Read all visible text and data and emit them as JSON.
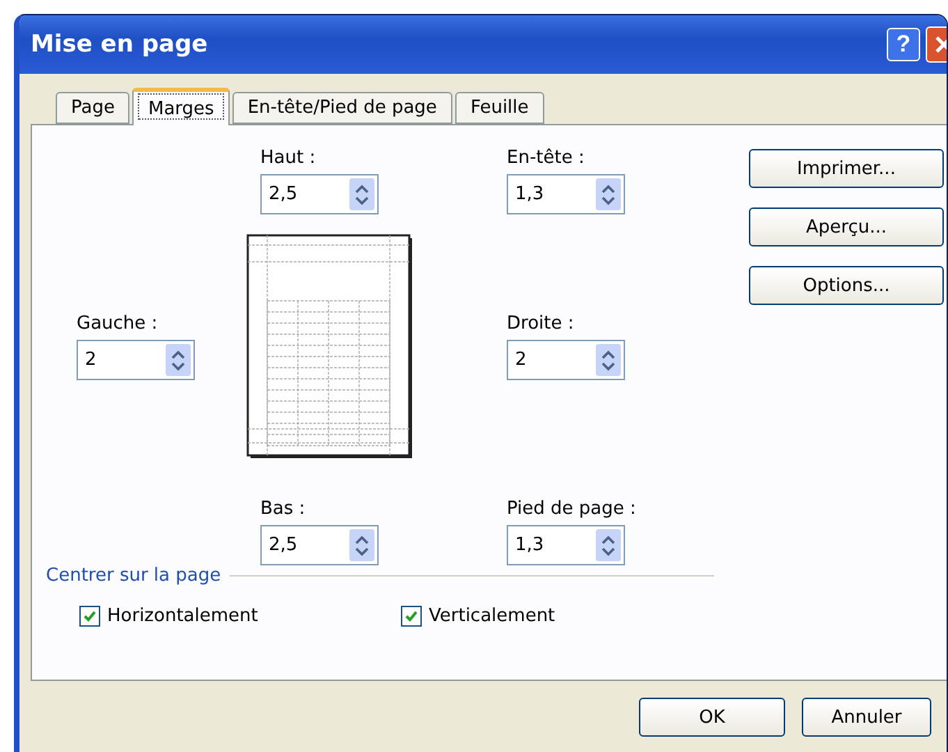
{
  "window": {
    "title": "Mise en page",
    "help": "?"
  },
  "tabs": [
    {
      "label": "Page",
      "selected": false
    },
    {
      "label": "Marges",
      "selected": true
    },
    {
      "label": "En-tête/Pied de page",
      "selected": false
    },
    {
      "label": "Feuille",
      "selected": false
    }
  ],
  "margins": {
    "top": {
      "label": "Haut :",
      "value": "2,5"
    },
    "header": {
      "label": "En-tête :",
      "value": "1,3"
    },
    "left": {
      "label": "Gauche :",
      "value": "2"
    },
    "right": {
      "label": "Droite :",
      "value": "2"
    },
    "bottom": {
      "label": "Bas :",
      "value": "2,5"
    },
    "footer": {
      "label": "Pied de page :",
      "value": "1,3"
    }
  },
  "side_buttons": [
    "Imprimer...",
    "Aperçu...",
    "Options..."
  ],
  "center": {
    "title": "Centrer sur la page",
    "options": [
      {
        "label": "Horizontalement",
        "checked": true
      },
      {
        "label": "Verticalement",
        "checked": true
      }
    ]
  },
  "buttons": [
    "OK",
    "Annuler"
  ]
}
